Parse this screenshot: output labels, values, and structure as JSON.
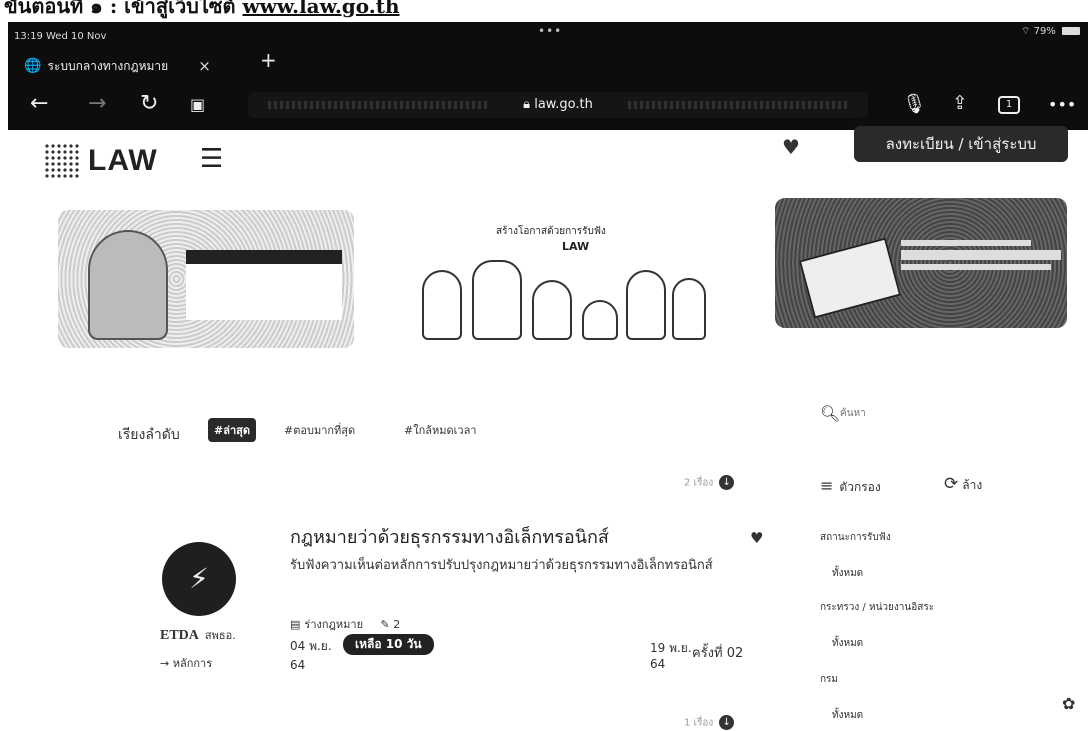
{
  "caption": {
    "text": "ขั้นตอนที่ ๑ : เข้าสู่เว็บไซต์",
    "link": "www.law.go.th"
  },
  "status": {
    "time": "13:19  Wed 10 Nov",
    "dots": "•••",
    "battery": "79%"
  },
  "tab": {
    "title": "ระบบกลางทางกฎหมาย",
    "close": "×",
    "new": "+"
  },
  "toolbar": {
    "url": "law.go.th",
    "tab_count": "1",
    "more": "•••"
  },
  "header": {
    "logo": "LAW",
    "login_label": "ลงทะเบียน / เข้าสู่ระบบ"
  },
  "banners": {
    "b2_title": "สร้างโอกาสด้วยการรับฟัง",
    "b2_logo": "LAW"
  },
  "sort": {
    "label": "เรียงลำดับ",
    "options": [
      "#ล่าสุด",
      "#ตอบมากที่สุด",
      "#ใกล้หมดเวลา"
    ]
  },
  "search": {
    "placeholder": "ค้นหา"
  },
  "list": {
    "count_top": "2 เรื่อง",
    "count_bottom": "1 เรื่อง"
  },
  "filters": {
    "title": "ตัวกรอง",
    "clear": "ล้าง",
    "groups": [
      {
        "title": "สถานะการรับฟัง",
        "value": "ทั้งหมด"
      },
      {
        "title": "กระทรวง / หน่วยงานอิสระ",
        "value": "ทั้งหมด"
      },
      {
        "title": "กรม",
        "value": "ทั้งหมด"
      }
    ]
  },
  "item": {
    "title": "กฎหมายว่าด้วยธุรกรรมทางอิเล็กทรอนิกส์",
    "description": "รับฟังความเห็นต่อหลักการปรับปรุงกฎหมายว่าด้วยธุรกรรมทางอิเล็กทรอนิกส์",
    "agency_short": "ETDA",
    "agency_name": "สพธอ.",
    "principle": "หลักการ",
    "meta_type": "ร่างกฎหมาย",
    "meta_count": "2",
    "open_date": "04 พ.ย.",
    "open_year": "64",
    "remaining": "เหลือ 10 วัน",
    "close_date": "19 พ.ย.",
    "close_year": "64",
    "round": "ครั้งที่ 02"
  }
}
